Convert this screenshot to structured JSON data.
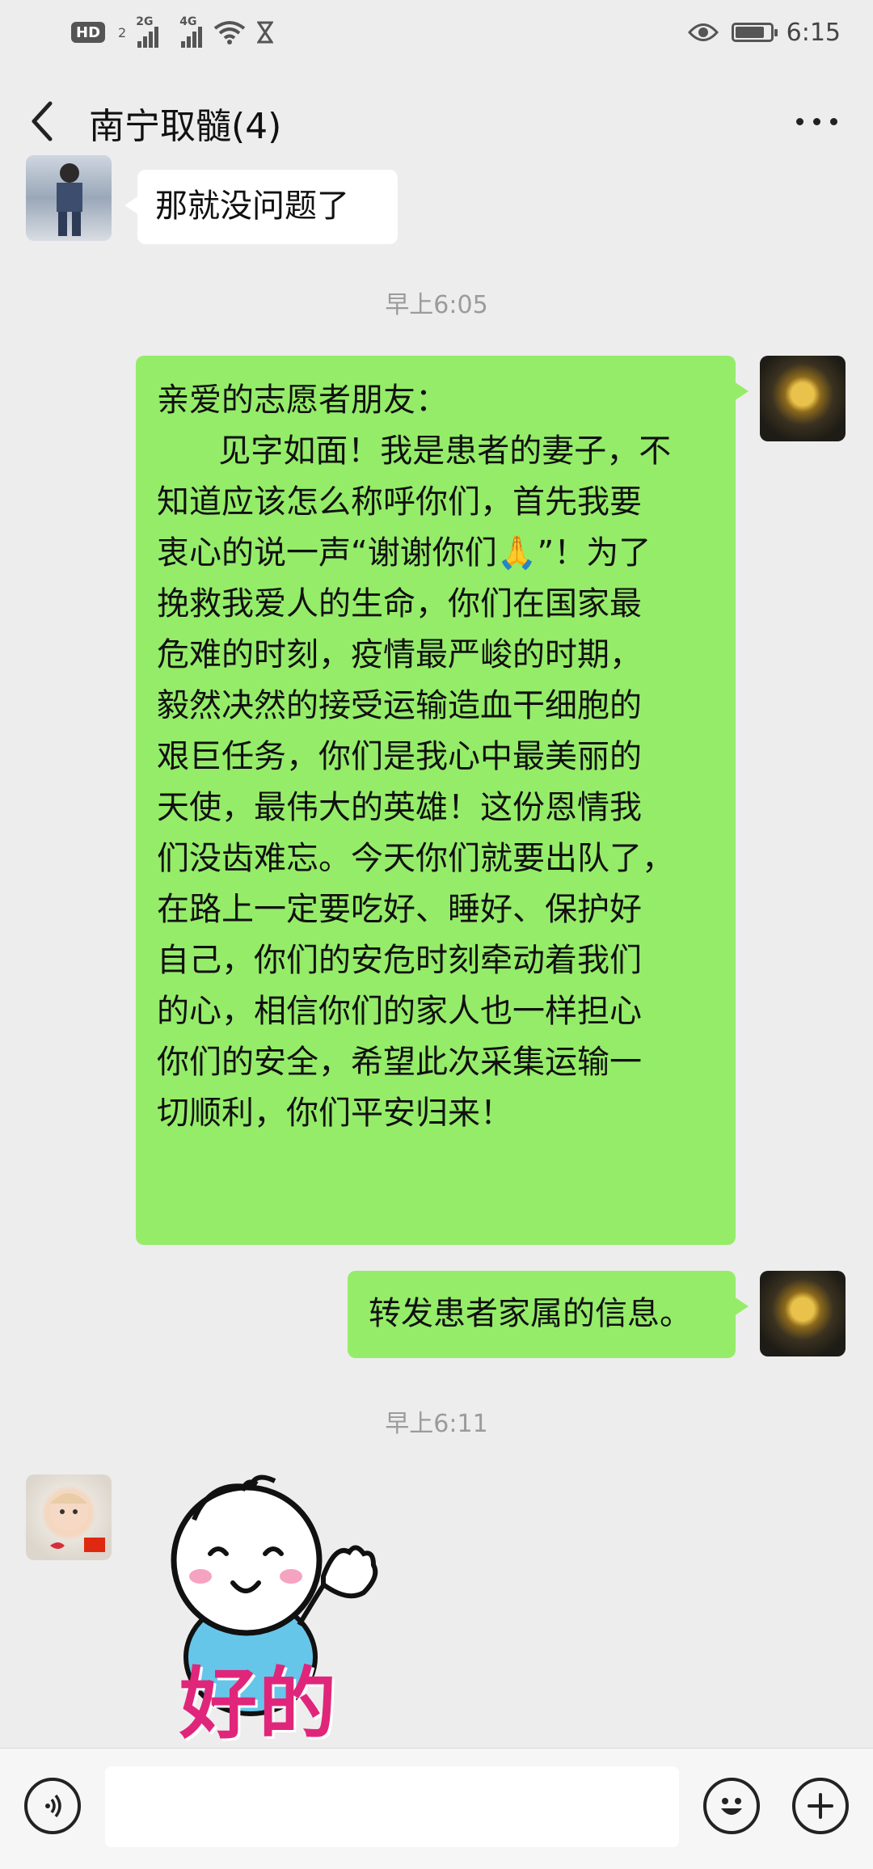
{
  "status_bar": {
    "hd_label": "HD",
    "hd_sub": "2",
    "sim1_gen": "2G",
    "sim2_gen": "4G",
    "time": "6:15",
    "battery_level": 0.85
  },
  "header": {
    "title": "南宁取髓(4)"
  },
  "messages": {
    "m1": {
      "text": "那就没问题了",
      "side": "left"
    },
    "ts1": "早上6:05",
    "m2": {
      "text": "亲爱的志愿者朋友：\n      见字如面！我是患者的妻子，不\n知道应该怎么称呼你们，首先我要\n衷心的说一声“谢谢你们🙏”！为了\n挽救我爱人的生命，你们在国家最\n危难的时刻，疫情最严峻的时期，\n毅然决然的接受运输造血干细胞的\n艰巨任务，你们是我心中最美丽的\n天使，最伟大的英雄！这份恩情我\n们没齿难忘。今天你们就要出队了，\n在路上一定要吃好、睡好、保护好\n自己，你们的安危时刻牵动着我们\n的心，相信你们的家人也一样担心\n你们的安全，希望此次采集运输一\n切顺利，你们平安归来！",
      "side": "right"
    },
    "m3": {
      "text": "转发患者家属的信息。",
      "side": "right"
    },
    "ts2": "早上6:11",
    "sticker_text": "好的"
  },
  "input_bar": {
    "placeholder": ""
  },
  "colors": {
    "background": "#ededed",
    "sent_bubble": "#95ec69",
    "received_bubble": "#ffffff",
    "sticker_text": "#e0267a"
  },
  "icons": [
    "back-arrow-icon",
    "more-icon",
    "voice-icon",
    "emoji-icon",
    "plus-icon",
    "signal-icon",
    "wifi-icon",
    "eye-icon",
    "battery-icon"
  ]
}
